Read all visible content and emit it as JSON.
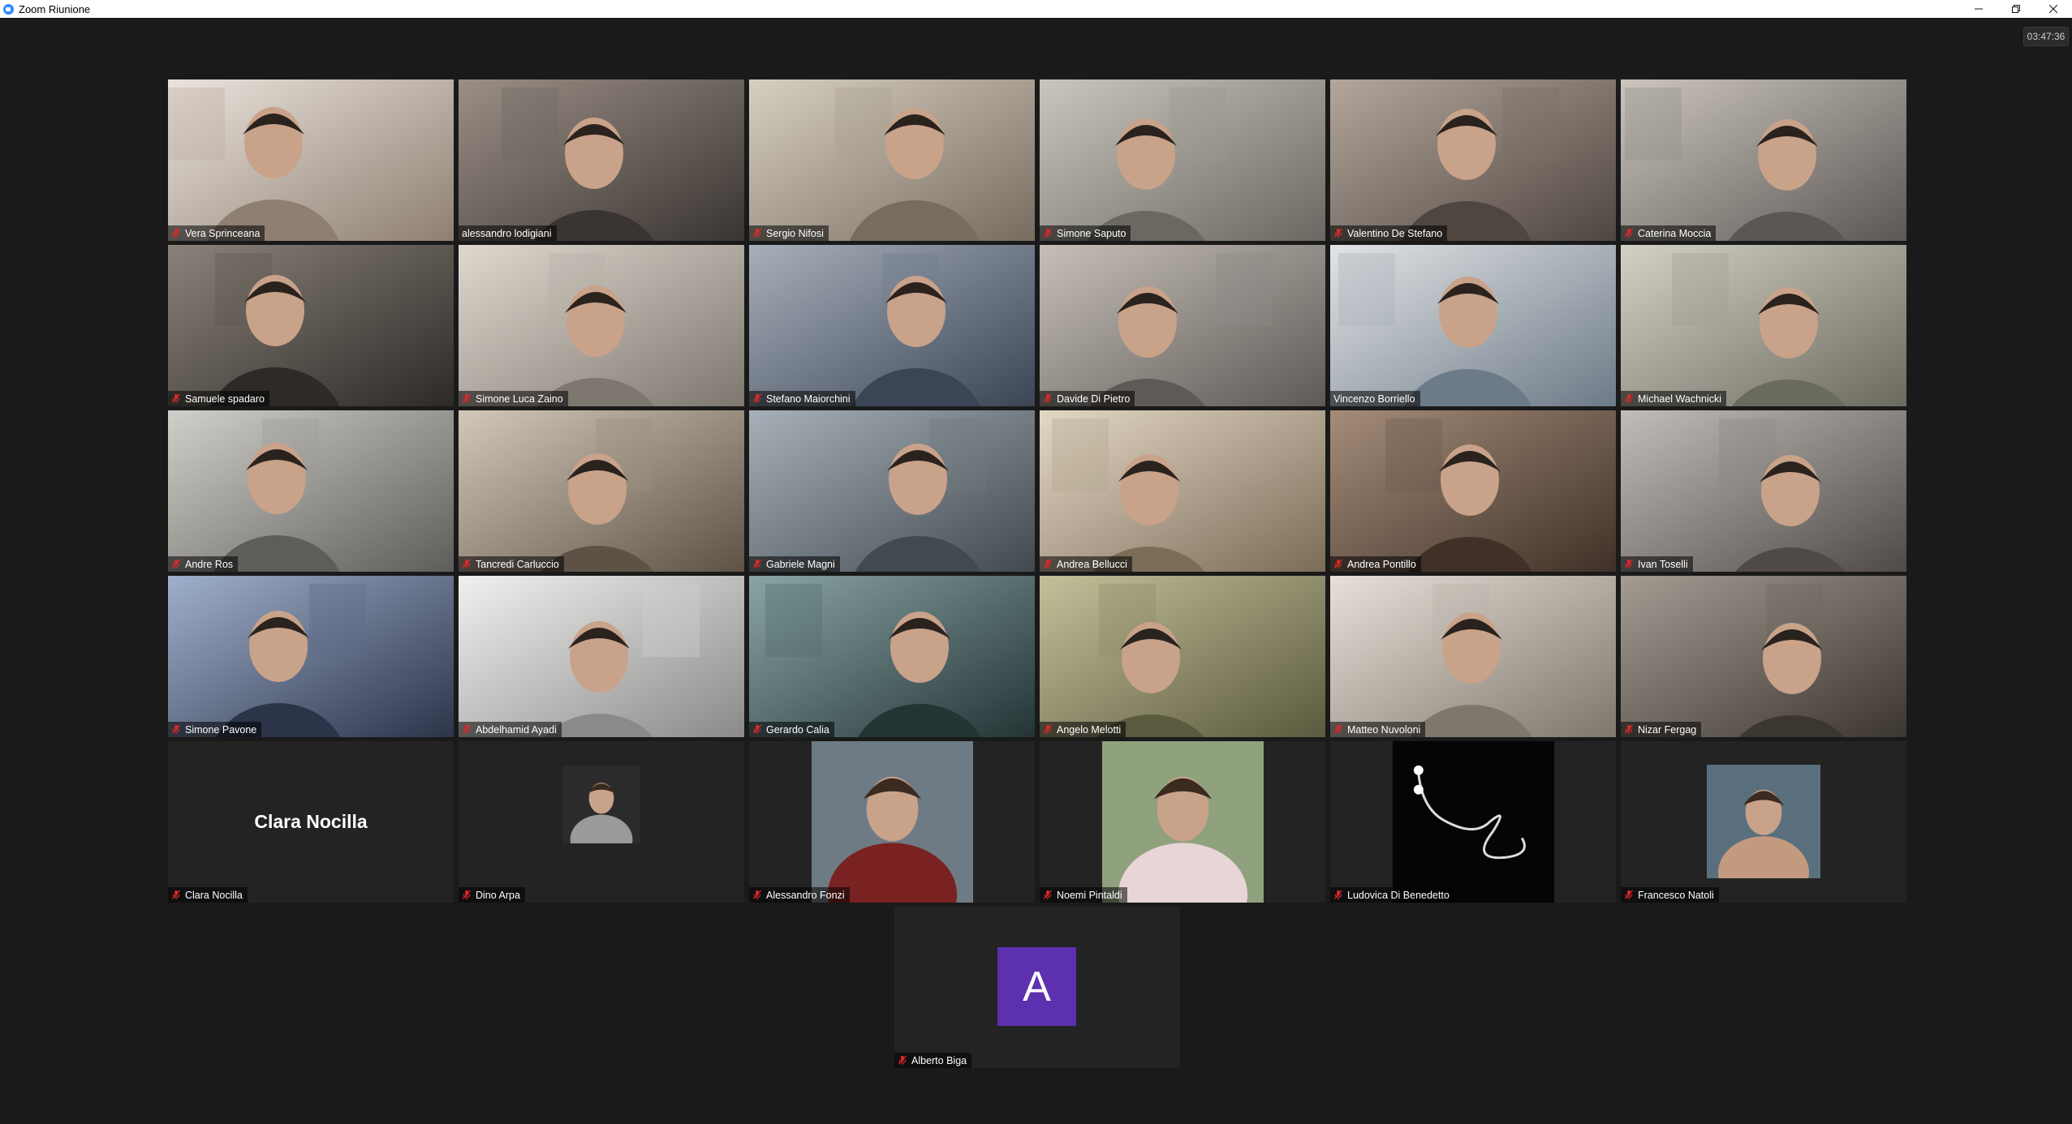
{
  "window": {
    "title": "Zoom Riunione",
    "minimize_icon": "minimize-icon",
    "restore_icon": "restore-icon",
    "close_icon": "close-icon"
  },
  "meeting": {
    "elapsed_time": "03:47:36"
  },
  "participants": [
    {
      "name": "Vera Sprinceana",
      "muted": true
    },
    {
      "name": "alessandro lodigiani",
      "muted": false
    },
    {
      "name": "Sergio Nifosi",
      "muted": true
    },
    {
      "name": "Simone Saputo",
      "muted": true
    },
    {
      "name": "Valentino De Stefano",
      "muted": true
    },
    {
      "name": "Caterina Moccia",
      "muted": true
    },
    {
      "name": "Samuele spadaro",
      "muted": true
    },
    {
      "name": "Simone Luca Zaino",
      "muted": true
    },
    {
      "name": "Stefano Maiorchini",
      "muted": true
    },
    {
      "name": "Davide Di Pietro",
      "muted": true
    },
    {
      "name": "Vincenzo Borriello",
      "muted": false,
      "active_speaker": true
    },
    {
      "name": "Michael Wachnicki",
      "muted": true
    },
    {
      "name": "Andre Ros",
      "muted": true
    },
    {
      "name": "Tancredi Carluccio",
      "muted": true
    },
    {
      "name": "Gabriele Magni",
      "muted": true
    },
    {
      "name": "Andrea Bellucci",
      "muted": true
    },
    {
      "name": "Andrea Pontillo",
      "muted": true
    },
    {
      "name": "Ivan Toselli",
      "muted": true
    },
    {
      "name": "Simone Pavone",
      "muted": true
    },
    {
      "name": "Abdelhamid Ayadi",
      "muted": true
    },
    {
      "name": "Gerardo Calia",
      "muted": true
    },
    {
      "name": "Angelo Melotti",
      "muted": true
    },
    {
      "name": "Matteo Nuvoloni",
      "muted": true
    },
    {
      "name": "Nizar Fergag",
      "muted": true
    },
    {
      "name": "Clara Nocilla",
      "muted": true,
      "video_off": true,
      "display_name": "Clara Nocilla"
    },
    {
      "name": "Dino Arpa",
      "muted": true
    },
    {
      "name": "Alessandro Fonzi",
      "muted": true
    },
    {
      "name": "Noemi Pintaldi",
      "muted": true
    },
    {
      "name": "Ludovica Di Benedetto",
      "muted": true
    },
    {
      "name": "Francesco Natoli",
      "muted": true
    },
    {
      "name": "Alberto Biga",
      "muted": true,
      "avatar_letter": "A"
    }
  ],
  "colors": {
    "background": "#1a1a1a",
    "tile": "#232323",
    "active_speaker_border": "#c7d63a",
    "mute_icon": "#e02828",
    "avatar_letter_bg": "#5d30b0"
  }
}
